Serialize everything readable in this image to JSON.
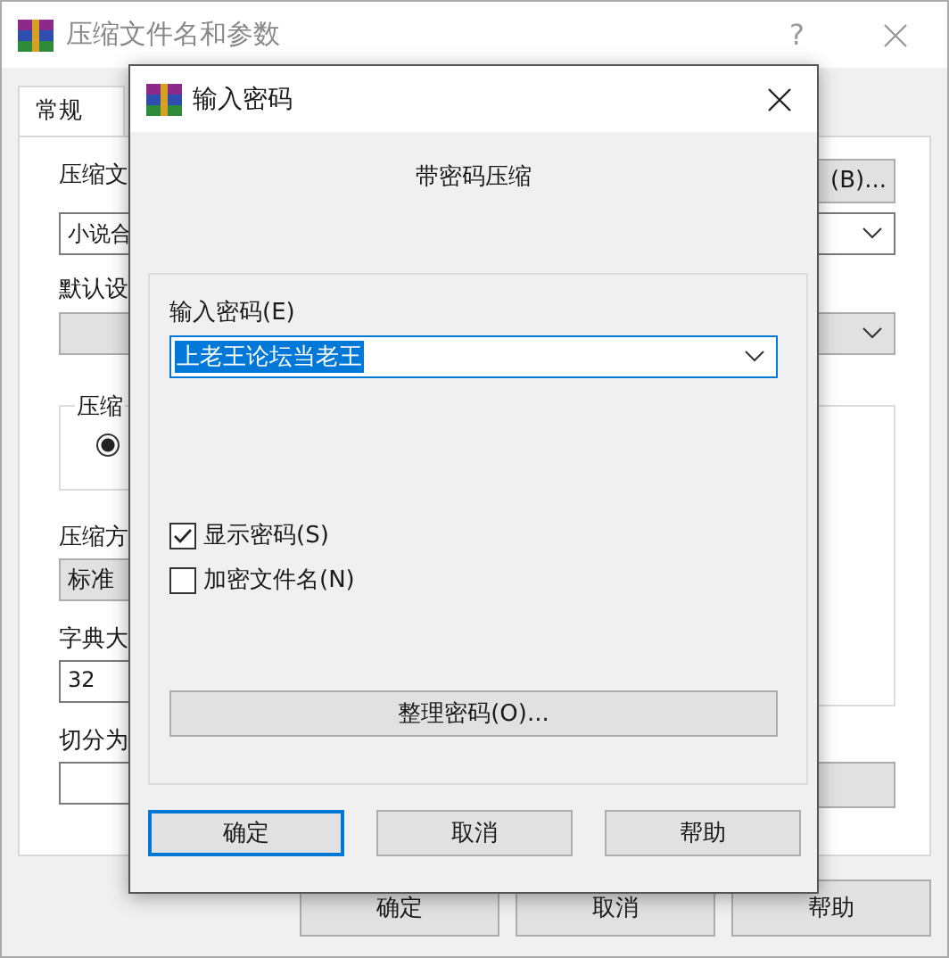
{
  "back_window": {
    "title": "压缩文件名和参数",
    "help": "?",
    "tabs": [
      {
        "label": "常规",
        "selected": true
      }
    ],
    "archive_name_label": "压缩文",
    "browse_button": "(B)...",
    "archive_name_value": "小说合",
    "profile_label": "默认设",
    "format_group_label": "压缩",
    "format_radio": {
      "selected": true
    },
    "method_label": "压缩方",
    "method_value": "标准",
    "dict_label": "字典大",
    "dict_value": "32",
    "split_label": "切分为",
    "buttons": [
      "确定",
      "取消",
      "帮助"
    ]
  },
  "dialog": {
    "title": "输入密码",
    "heading": "带密码压缩",
    "password_label": "输入密码(E)",
    "password": {
      "value": "上老王论坛当老王",
      "selected": true
    },
    "options": [
      {
        "label": "显示密码(S)",
        "checked": true
      },
      {
        "label": "加密文件名(N)",
        "checked": false
      }
    ],
    "manage_button": "整理密码(O)...",
    "buttons": [
      {
        "label": "确定",
        "default": true
      },
      {
        "label": "取消",
        "default": false
      },
      {
        "label": "帮助",
        "default": false
      }
    ]
  }
}
